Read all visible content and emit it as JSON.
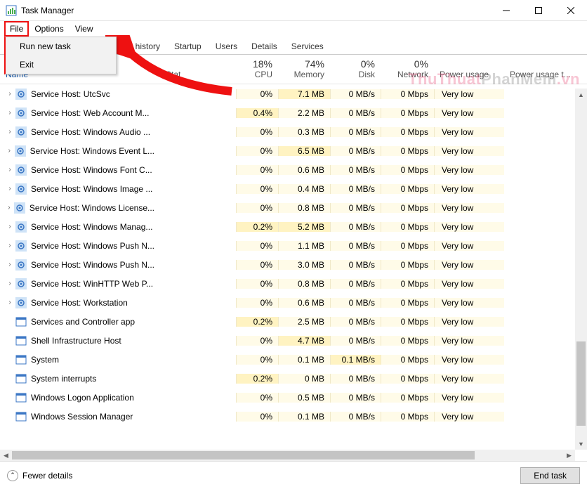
{
  "window": {
    "title": "Task Manager"
  },
  "menu": {
    "file": "File",
    "options": "Options",
    "view": "View"
  },
  "file_menu": {
    "run": "Run new task",
    "exit": "Exit"
  },
  "tabs": {
    "app_history": "pp history",
    "startup": "Startup",
    "users": "Users",
    "details": "Details",
    "services": "Services"
  },
  "columns": {
    "name": "Name",
    "status": "Stat",
    "cpu_pct": "18%",
    "cpu": "CPU",
    "mem_pct": "74%",
    "mem": "Memory",
    "disk_pct": "0%",
    "disk": "Disk",
    "net_pct": "0%",
    "net": "Network",
    "power": "Power usage",
    "power_trend": "Power usage t..."
  },
  "footer": {
    "fewer": "Fewer details",
    "end": "End task"
  },
  "watermark_a": "ThuThuat",
  "watermark_b": "PhanMem",
  "watermark_c": ".vn",
  "rows": [
    {
      "icon": "gear",
      "name": "Service Host: UtcSvc",
      "cpu": "0%",
      "cpu_h": 0,
      "mem": "7.1 MB",
      "mem_h": 1,
      "disk": "0 MB/s",
      "net": "0 Mbps",
      "pw": "Very low",
      "exp": true
    },
    {
      "icon": "gear",
      "name": "Service Host: Web Account M...",
      "cpu": "0.4%",
      "cpu_h": 1,
      "mem": "2.2 MB",
      "mem_h": 0,
      "disk": "0 MB/s",
      "net": "0 Mbps",
      "pw": "Very low",
      "exp": true
    },
    {
      "icon": "gear",
      "name": "Service Host: Windows Audio ...",
      "cpu": "0%",
      "cpu_h": 0,
      "mem": "0.3 MB",
      "mem_h": 0,
      "disk": "0 MB/s",
      "net": "0 Mbps",
      "pw": "Very low",
      "exp": true
    },
    {
      "icon": "gear",
      "name": "Service Host: Windows Event L...",
      "cpu": "0%",
      "cpu_h": 0,
      "mem": "6.5 MB",
      "mem_h": 1,
      "disk": "0 MB/s",
      "net": "0 Mbps",
      "pw": "Very low",
      "exp": true
    },
    {
      "icon": "gear",
      "name": "Service Host: Windows Font C...",
      "cpu": "0%",
      "cpu_h": 0,
      "mem": "0.6 MB",
      "mem_h": 0,
      "disk": "0 MB/s",
      "net": "0 Mbps",
      "pw": "Very low",
      "exp": true
    },
    {
      "icon": "gear",
      "name": "Service Host: Windows Image ...",
      "cpu": "0%",
      "cpu_h": 0,
      "mem": "0.4 MB",
      "mem_h": 0,
      "disk": "0 MB/s",
      "net": "0 Mbps",
      "pw": "Very low",
      "exp": true
    },
    {
      "icon": "gear",
      "name": "Service Host: Windows License...",
      "cpu": "0%",
      "cpu_h": 0,
      "mem": "0.8 MB",
      "mem_h": 0,
      "disk": "0 MB/s",
      "net": "0 Mbps",
      "pw": "Very low",
      "exp": true
    },
    {
      "icon": "gear",
      "name": "Service Host: Windows Manag...",
      "cpu": "0.2%",
      "cpu_h": 1,
      "mem": "5.2 MB",
      "mem_h": 1,
      "disk": "0 MB/s",
      "net": "0 Mbps",
      "pw": "Very low",
      "exp": true
    },
    {
      "icon": "gear",
      "name": "Service Host: Windows Push N...",
      "cpu": "0%",
      "cpu_h": 0,
      "mem": "1.1 MB",
      "mem_h": 0,
      "disk": "0 MB/s",
      "net": "0 Mbps",
      "pw": "Very low",
      "exp": true
    },
    {
      "icon": "gear",
      "name": "Service Host: Windows Push N...",
      "cpu": "0%",
      "cpu_h": 0,
      "mem": "3.0 MB",
      "mem_h": 0,
      "disk": "0 MB/s",
      "net": "0 Mbps",
      "pw": "Very low",
      "exp": true
    },
    {
      "icon": "gear",
      "name": "Service Host: WinHTTP Web P...",
      "cpu": "0%",
      "cpu_h": 0,
      "mem": "0.8 MB",
      "mem_h": 0,
      "disk": "0 MB/s",
      "net": "0 Mbps",
      "pw": "Very low",
      "exp": true
    },
    {
      "icon": "gear",
      "name": "Service Host: Workstation",
      "cpu": "0%",
      "cpu_h": 0,
      "mem": "0.6 MB",
      "mem_h": 0,
      "disk": "0 MB/s",
      "net": "0 Mbps",
      "pw": "Very low",
      "exp": true
    },
    {
      "icon": "app",
      "name": "Services and Controller app",
      "cpu": "0.2%",
      "cpu_h": 1,
      "mem": "2.5 MB",
      "mem_h": 0,
      "disk": "0 MB/s",
      "net": "0 Mbps",
      "pw": "Very low",
      "exp": false
    },
    {
      "icon": "app",
      "name": "Shell Infrastructure Host",
      "cpu": "0%",
      "cpu_h": 0,
      "mem": "4.7 MB",
      "mem_h": 1,
      "disk": "0 MB/s",
      "net": "0 Mbps",
      "pw": "Very low",
      "exp": false
    },
    {
      "icon": "app",
      "name": "System",
      "cpu": "0%",
      "cpu_h": 0,
      "mem": "0.1 MB",
      "mem_h": 0,
      "disk": "0.1 MB/s",
      "disk_h": 1,
      "net": "0 Mbps",
      "pw": "Very low",
      "exp": false
    },
    {
      "icon": "app",
      "name": "System interrupts",
      "cpu": "0.2%",
      "cpu_h": 1,
      "mem": "0 MB",
      "mem_h": 0,
      "disk": "0 MB/s",
      "net": "0 Mbps",
      "pw": "Very low",
      "exp": false
    },
    {
      "icon": "app",
      "name": "Windows Logon Application",
      "cpu": "0%",
      "cpu_h": 0,
      "mem": "0.5 MB",
      "mem_h": 0,
      "disk": "0 MB/s",
      "net": "0 Mbps",
      "pw": "Very low",
      "exp": false
    },
    {
      "icon": "app",
      "name": "Windows Session Manager",
      "cpu": "0%",
      "cpu_h": 0,
      "mem": "0.1 MB",
      "mem_h": 0,
      "disk": "0 MB/s",
      "net": "0 Mbps",
      "pw": "Very low",
      "exp": false
    }
  ]
}
